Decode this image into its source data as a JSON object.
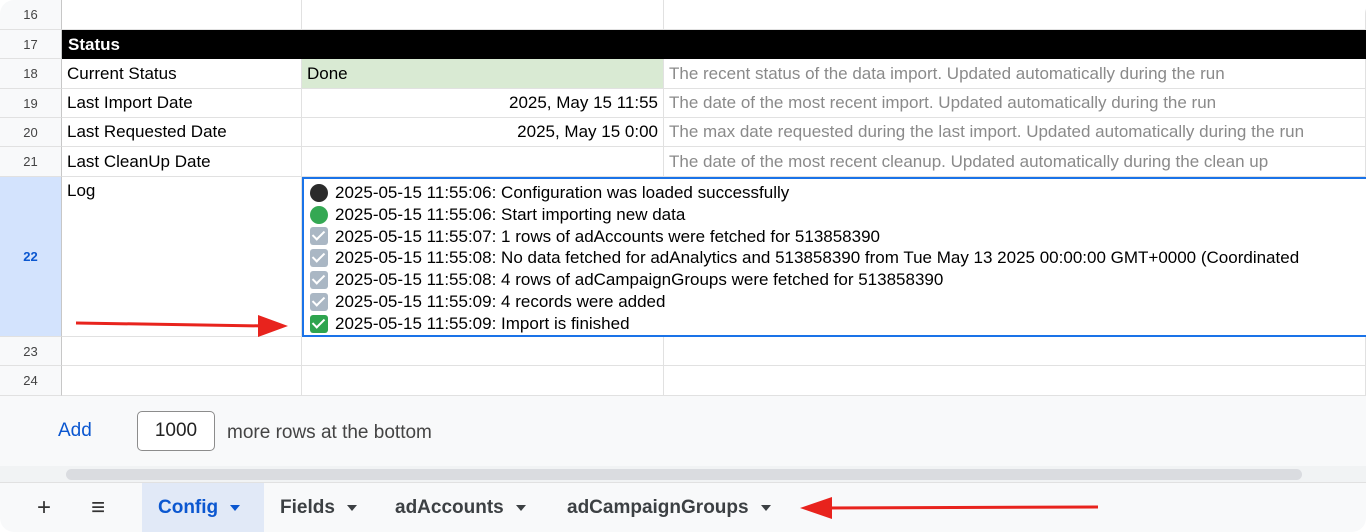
{
  "grid": {
    "rows": [
      {
        "num": "16"
      },
      {
        "num": "17",
        "section": "Status"
      },
      {
        "num": "18",
        "label": "Current Status",
        "value": "Done",
        "desc": "The recent status of the data import. Updated automatically during the run"
      },
      {
        "num": "19",
        "label": "Last Import Date",
        "value": "2025, May 15 11:55",
        "desc": "The date of the most recent import. Updated automatically during the run"
      },
      {
        "num": "20",
        "label": "Last Requested Date",
        "value": "2025, May 15 0:00",
        "desc": "The max date requested during the last import. Updated automatically during the run"
      },
      {
        "num": "21",
        "label": "Last CleanUp Date",
        "value": "",
        "desc": "The date of the most recent cleanup. Updated automatically during the clean up"
      },
      {
        "num": "22",
        "label": "Log"
      },
      {
        "num": "23"
      },
      {
        "num": "24"
      }
    ],
    "log": [
      {
        "icon": "black-circle-icon",
        "text": "2025-05-15 11:55:06: Configuration was loaded successfully"
      },
      {
        "icon": "green-circle-icon",
        "text": "2025-05-15 11:55:06: Start importing new data"
      },
      {
        "icon": "checkbox-icon",
        "text": "2025-05-15 11:55:07: 1 rows of adAccounts were fetched for 513858390"
      },
      {
        "icon": "checkbox-icon",
        "text": "2025-05-15 11:55:08: No data fetched for adAnalytics and 513858390 from Tue May 13 2025 00:00:00 GMT+0000 (Coordinated"
      },
      {
        "icon": "checkbox-icon",
        "text": "2025-05-15 11:55:08: 4 rows of adCampaignGroups were fetched for 513858390"
      },
      {
        "icon": "checkbox-icon",
        "text": "2025-05-15 11:55:09: 4 records were added"
      },
      {
        "icon": "green-check-icon",
        "text": "2025-05-15 11:55:09: Import is finished"
      }
    ]
  },
  "add_rows": {
    "button": "Add",
    "count": "1000",
    "suffix": "more rows at the bottom"
  },
  "tabs": {
    "add_icon": "+",
    "menu_icon": "≡",
    "items": [
      {
        "label": "Config",
        "active": true
      },
      {
        "label": "Fields"
      },
      {
        "label": "adAccounts"
      },
      {
        "label": "adCampaignGroups"
      }
    ]
  },
  "colors": {
    "done_fill": "#d9ead3",
    "selection": "#1a73e8",
    "annotation_arrow": "#e8231d"
  }
}
